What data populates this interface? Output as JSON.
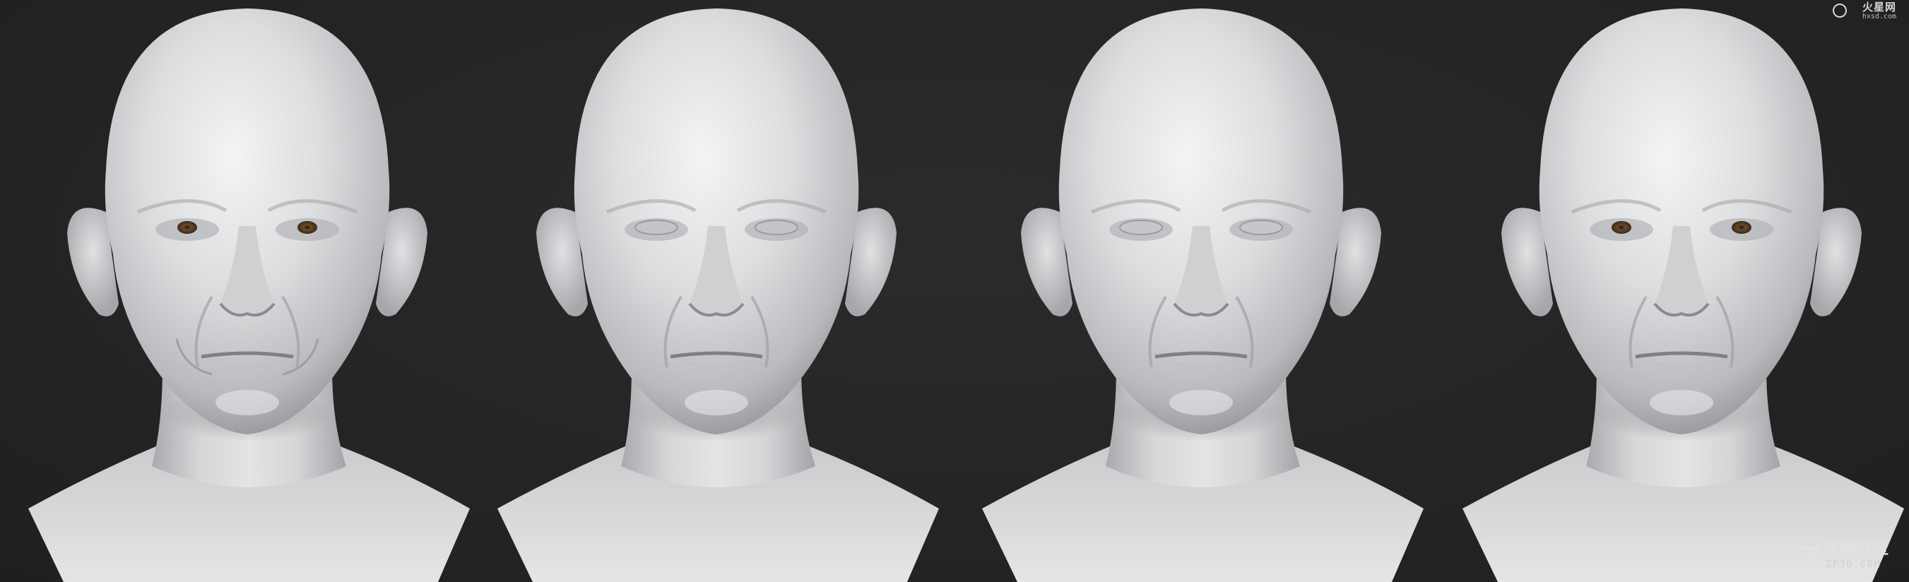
{
  "scene": {
    "background_color": "#252525",
    "subject": "four head sculpt renders",
    "busts": [
      {
        "id": 1,
        "eyes": "painted-brown",
        "expression": "smile"
      },
      {
        "id": 2,
        "eyes": "blank",
        "expression": "neutral"
      },
      {
        "id": 3,
        "eyes": "blank",
        "expression": "slight-smile"
      },
      {
        "id": 4,
        "eyes": "painted-brown",
        "expression": "slight-smile"
      }
    ],
    "clay_color": "#d9dadb",
    "iris_color": "#6a4a2c"
  },
  "watermarks": {
    "top_right_main": "火星网",
    "top_right_sub": "hxsd.com",
    "bottom_right_main": "朱峰社区",
    "bottom_right_sub": "ZF3D.COM"
  }
}
